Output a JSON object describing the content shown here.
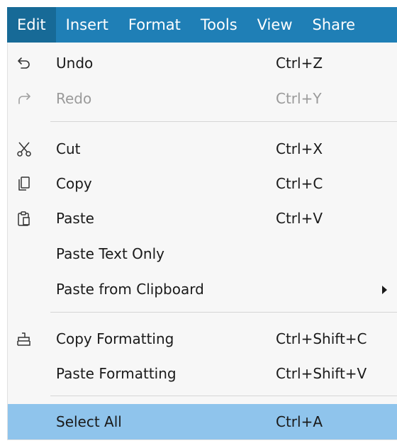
{
  "menubar": {
    "items": [
      {
        "label": "Edit",
        "active": true
      },
      {
        "label": "Insert"
      },
      {
        "label": "Format"
      },
      {
        "label": "Tools"
      },
      {
        "label": "View"
      },
      {
        "label": "Share"
      }
    ]
  },
  "edit_menu": {
    "undo": {
      "label": "Undo",
      "shortcut": "Ctrl+Z",
      "icon": "undo-icon"
    },
    "redo": {
      "label": "Redo",
      "shortcut": "Ctrl+Y",
      "icon": "redo-icon",
      "disabled": true
    },
    "cut": {
      "label": "Cut",
      "shortcut": "Ctrl+X",
      "icon": "scissors-icon"
    },
    "copy": {
      "label": "Copy",
      "shortcut": "Ctrl+C",
      "icon": "copy-icon"
    },
    "paste": {
      "label": "Paste",
      "shortcut": "Ctrl+V",
      "icon": "clipboard-icon"
    },
    "paste_text_only": {
      "label": "Paste Text Only"
    },
    "paste_from_clipboard": {
      "label": "Paste from Clipboard",
      "has_submenu": true
    },
    "copy_formatting": {
      "label": "Copy Formatting",
      "shortcut": "Ctrl+Shift+C",
      "icon": "format-painter-icon"
    },
    "paste_formatting": {
      "label": "Paste Formatting",
      "shortcut": "Ctrl+Shift+V"
    },
    "select_all": {
      "label": "Select All",
      "shortcut": "Ctrl+A",
      "selected": true
    }
  },
  "colors": {
    "menubar_bg": "#1f7fb6",
    "active_menu_bg": "#176a97",
    "selected_row_bg": "#8fc4ec",
    "disabled_text": "#9a9a9a"
  }
}
